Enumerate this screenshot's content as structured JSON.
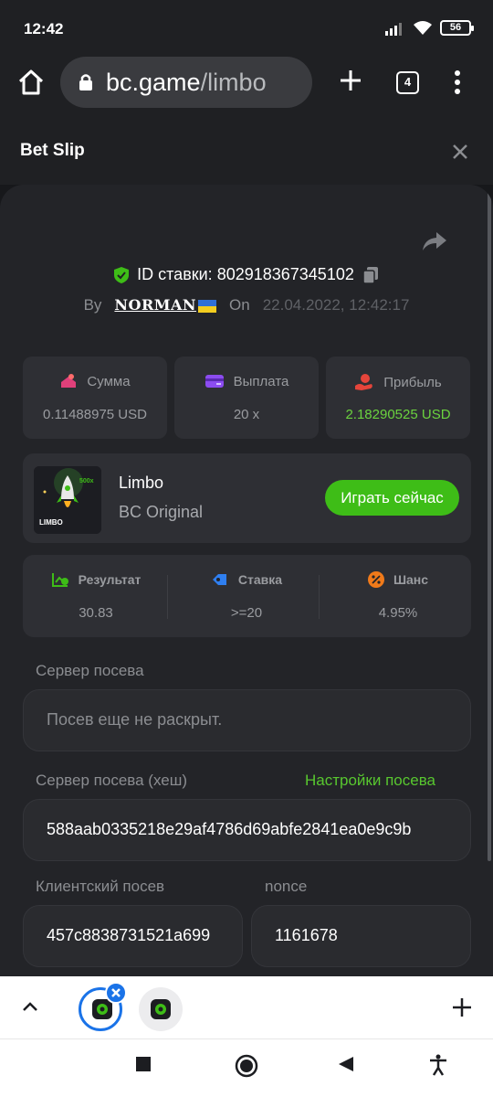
{
  "status_bar": {
    "time": "12:42",
    "battery": "56"
  },
  "browser": {
    "url_host": "bc.game",
    "url_path": "/limbo",
    "tab_count": "4"
  },
  "slip": {
    "title": "Bet Slip"
  },
  "bet": {
    "id_label": "ID ставки: 802918367345102",
    "by_label": "By",
    "username": "NORMAN",
    "on_label": "On",
    "datetime": "22.04.2022, 12:42:17"
  },
  "stats": [
    {
      "label": "Сумма",
      "value": "0.11488975 USD"
    },
    {
      "label": "Выплата",
      "value": "20 x"
    },
    {
      "label": "Прибыль",
      "value": "2.18290525 USD"
    }
  ],
  "game": {
    "name": "Limbo",
    "subtitle": "BC Original",
    "thumb_label": "LIMBO",
    "thumb_multiplier": "500x",
    "play_label": "Играть сейчас"
  },
  "results": [
    {
      "label": "Результат",
      "value": "30.83"
    },
    {
      "label": "Ставка",
      "value": ">=20"
    },
    {
      "label": "Шанс",
      "value": "4.95%"
    }
  ],
  "seeds": {
    "server_seed_label": "Сервер посева",
    "server_seed_value": "Посев еще не раскрыт.",
    "server_hash_label": "Сервер посева (хеш)",
    "seed_settings_link": "Настройки посева",
    "server_hash_value": "588aab0335218e29af4786d69abfe2841ea0e9c9b",
    "client_seed_label": "Клиентский посев",
    "client_seed_value": "457c8838731521a699",
    "nonce_label": "nonce",
    "nonce_value": "1161678"
  },
  "colors": {
    "accent_green": "#3ebd17",
    "profit_green": "#6bd33f",
    "panel_bg": "#232428",
    "card_bg": "#2e2f34"
  }
}
